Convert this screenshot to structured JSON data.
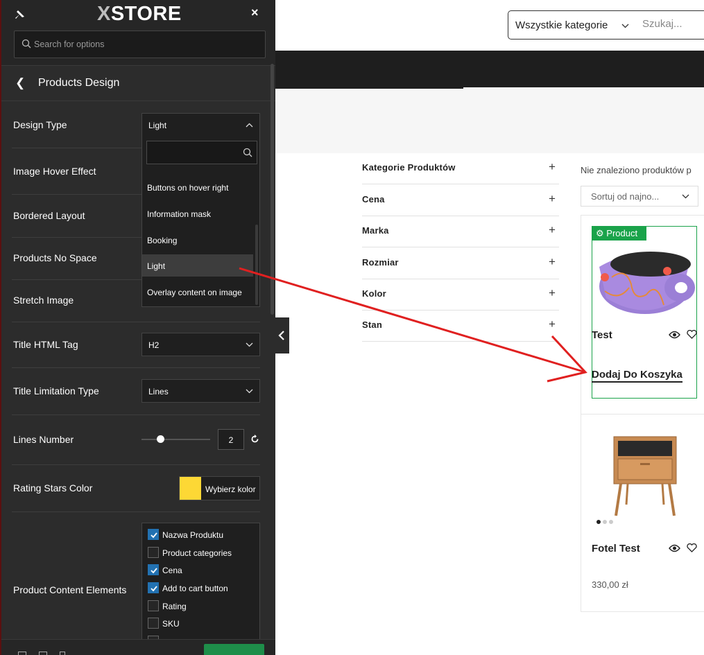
{
  "panel": {
    "logo_x": "X",
    "logo_store": "STORE",
    "close": "×",
    "search_placeholder": "Search for options",
    "section_title": "Products Design",
    "design_type": {
      "label": "Design Type",
      "value": "Light",
      "options": [
        "Buttons on hover right",
        "Information mask",
        "Booking",
        "Light",
        "Overlay content on image"
      ],
      "selected": "Light"
    },
    "image_hover": {
      "label": "Image Hover Effect"
    },
    "bordered": {
      "label": "Bordered Layout"
    },
    "no_space": {
      "label": "Products No Space"
    },
    "stretch": {
      "label": "Stretch Image"
    },
    "title_tag": {
      "label": "Title HTML Tag",
      "value": "H2"
    },
    "title_limit": {
      "label": "Title Limitation Type",
      "value": "Lines"
    },
    "lines_number": {
      "label": "Lines Number",
      "value": "2",
      "level": 0.27
    },
    "rating_color": {
      "label": "Rating Stars Color",
      "button": "Wybierz kolor",
      "color": "#fdd835"
    },
    "content_elements": {
      "label": "Product Content Elements",
      "items": [
        {
          "label": "Nazwa Produktu",
          "checked": true
        },
        {
          "label": "Product categories",
          "checked": false
        },
        {
          "label": "Cena",
          "checked": true
        },
        {
          "label": "Add to cart button",
          "checked": true
        },
        {
          "label": "Rating",
          "checked": false
        },
        {
          "label": "SKU",
          "checked": false
        }
      ]
    }
  },
  "header": {
    "category_select": "Wszystkie kategorie",
    "search_placeholder": "Szukaj..."
  },
  "filters": [
    {
      "label": "Kategorie Produktów"
    },
    {
      "label": "Cena"
    },
    {
      "label": "Marka"
    },
    {
      "label": "Rozmiar"
    },
    {
      "label": "Kolor"
    },
    {
      "label": "Stan"
    }
  ],
  "filter_plus": "+",
  "shop": {
    "no_products": "Nie znaleziono produktów p",
    "sort": "Sortuj od najno...",
    "products": [
      {
        "badge": "Product",
        "title": "Test",
        "add_to_cart": "Dodaj Do Koszyka"
      },
      {
        "title": "Fotel Test",
        "price": "330,00 zł"
      }
    ]
  },
  "colors": {
    "accent": "#1aa34a",
    "arrow": "#e02020",
    "panel": "#2c2c2c"
  }
}
